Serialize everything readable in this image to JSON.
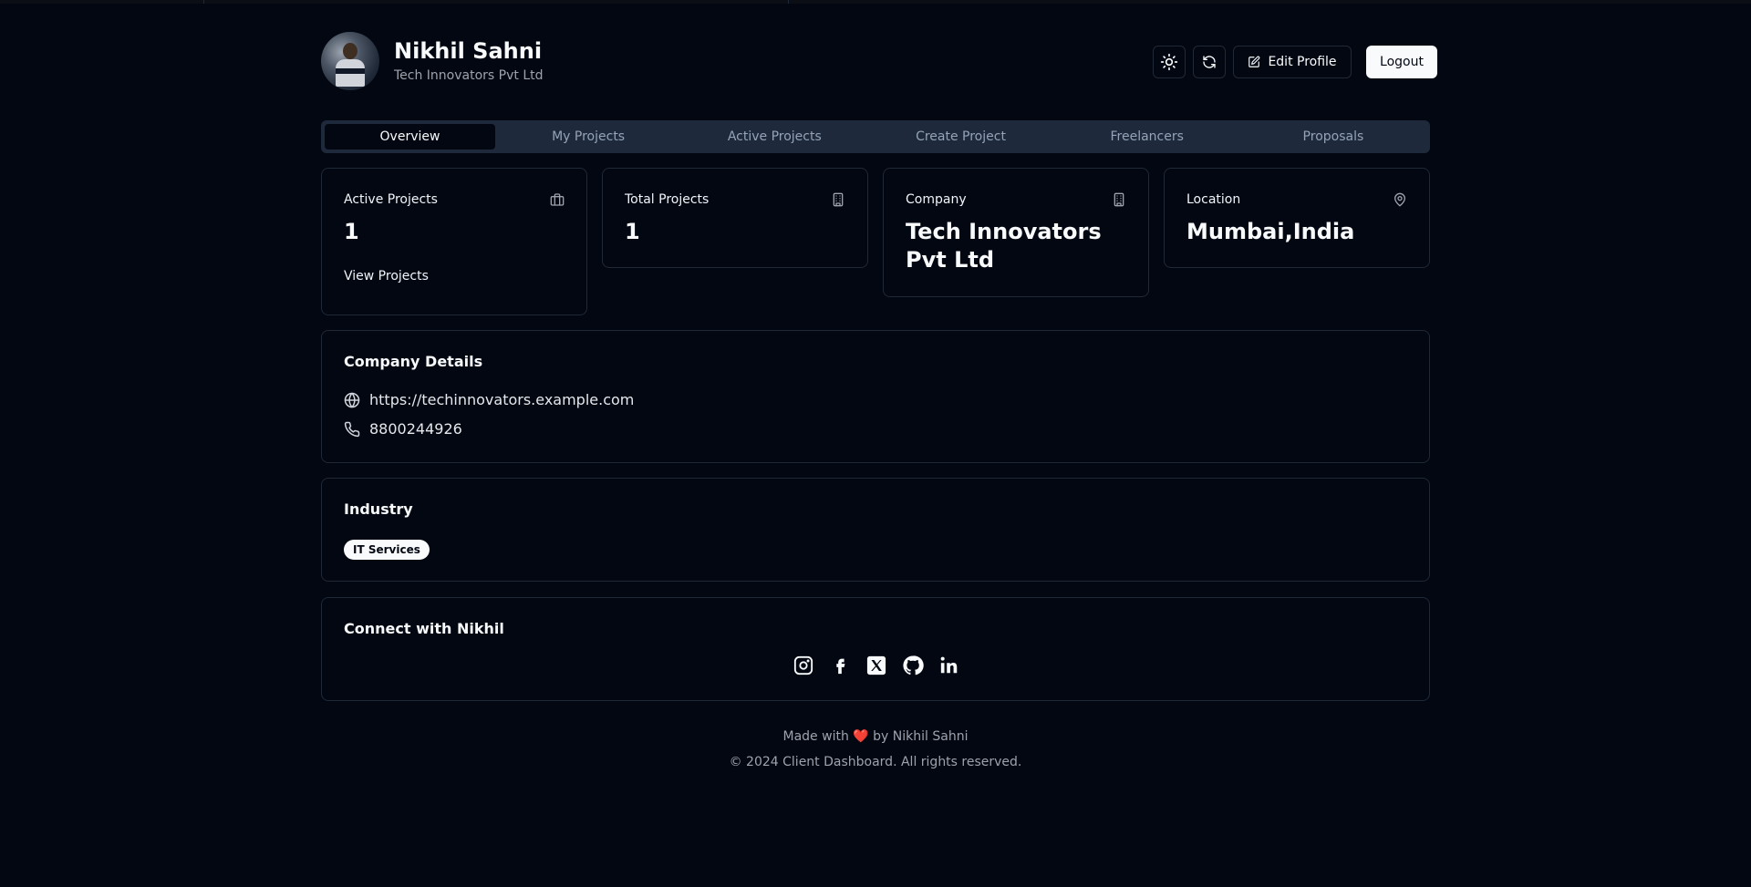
{
  "profile": {
    "name": "Nikhil Sahni",
    "company": "Tech Innovators Pvt Ltd"
  },
  "header": {
    "theme_icon": "sun-icon",
    "refresh_icon": "refresh-icon",
    "edit_label": "Edit Profile",
    "logout_label": "Logout"
  },
  "tabs": [
    {
      "label": "Overview",
      "active": true
    },
    {
      "label": "My Projects"
    },
    {
      "label": "Active Projects"
    },
    {
      "label": "Create Project"
    },
    {
      "label": "Freelancers"
    },
    {
      "label": "Proposals"
    }
  ],
  "stats": {
    "active_projects": {
      "label": "Active Projects",
      "value": "1",
      "link": "View Projects",
      "icon": "briefcase-icon"
    },
    "total_projects": {
      "label": "Total Projects",
      "value": "1",
      "icon": "building-icon"
    },
    "company": {
      "label": "Company",
      "value": "Tech Innovators Pvt Ltd",
      "icon": "building-icon"
    },
    "location": {
      "label": "Location",
      "value": "Mumbai,India",
      "icon": "map-pin-icon"
    }
  },
  "company_details": {
    "title": "Company Details",
    "website": "https://techinnovators.example.com",
    "phone": "8800244926"
  },
  "industry": {
    "title": "Industry",
    "tag": "IT Services"
  },
  "connect": {
    "title": "Connect with Nikhil",
    "icons": [
      "instagram-icon",
      "facebook-icon",
      "x-icon",
      "github-icon",
      "linkedin-icon"
    ]
  },
  "footer": {
    "made_prefix": "Made with",
    "heart": "❤️",
    "made_suffix": "by Nikhil Sahni",
    "copyright": "© 2024 Client Dashboard. All rights reserved."
  },
  "colors": {
    "background": "#030712",
    "border": "#1f2937",
    "tab_bar": "#1e293b",
    "muted_text": "#9ca3af"
  }
}
